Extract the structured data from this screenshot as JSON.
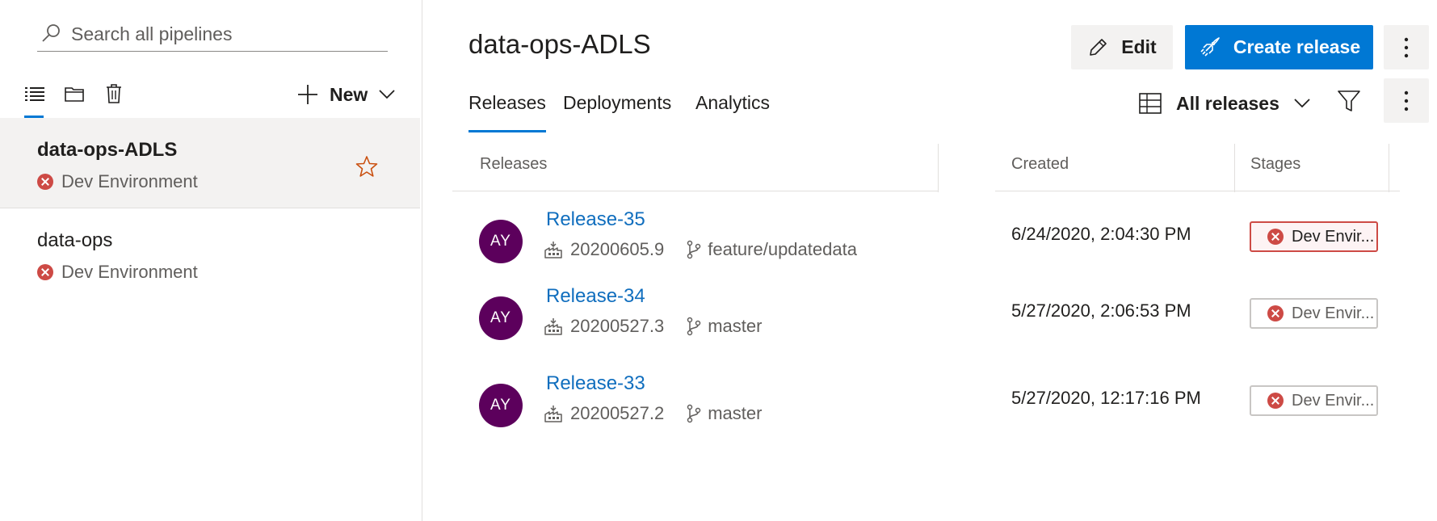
{
  "sidebar": {
    "search_placeholder": "Search all pipelines",
    "new_label": "New",
    "pipelines": [
      {
        "name": "data-ops-ADLS",
        "status": "Dev Environment",
        "selected": true
      },
      {
        "name": "data-ops",
        "status": "Dev Environment",
        "selected": false
      }
    ]
  },
  "header": {
    "title": "data-ops-ADLS",
    "edit_label": "Edit",
    "create_label": "Create release"
  },
  "tabs": [
    "Releases",
    "Deployments",
    "Analytics"
  ],
  "view_filter": "All releases",
  "table": {
    "headers": {
      "releases": "Releases",
      "created": "Created",
      "stages": "Stages"
    },
    "rows": [
      {
        "avatar": "AY",
        "name": "Release-35",
        "build": "20200605.9",
        "branch": "feature/updatedata",
        "created": "6/24/2020, 2:04:30 PM",
        "stage": "Dev Envir...",
        "stage_status": "failed-highlighted"
      },
      {
        "avatar": "AY",
        "name": "Release-34",
        "build": "20200527.3",
        "branch": "master",
        "created": "5/27/2020, 2:06:53 PM",
        "stage": "Dev Envir...",
        "stage_status": "failed"
      },
      {
        "avatar": "AY",
        "name": "Release-33",
        "build": "20200527.2",
        "branch": "master",
        "created": "5/27/2020, 12:17:16 PM",
        "stage": "Dev Envir...",
        "stage_status": "failed"
      }
    ]
  },
  "colors": {
    "accent": "#0078d4",
    "error": "#cd4a45",
    "avatar": "#5c005c",
    "link": "#106ebe"
  }
}
